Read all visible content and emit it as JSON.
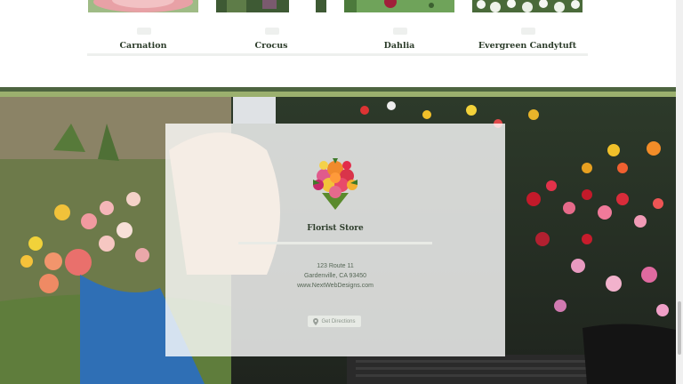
{
  "products": [
    {
      "name": "Carnation",
      "swatch": "#e8a1a6"
    },
    {
      "name": "Crocus",
      "swatch": "#7a5a6e"
    },
    {
      "name": "Dahlia",
      "swatch": "#6fa35a"
    },
    {
      "name": "Evergreen Candytuft",
      "swatch": "#dfe7d8"
    }
  ],
  "store": {
    "title": "Florist Store",
    "address_line1": "123 Route 11",
    "address_line2": "Gardenville, CA 93450",
    "website": "www.NextWebDesigns.com",
    "directions_label": "Get Directions",
    "directions_icon": "map-pin-icon"
  },
  "colors": {
    "band_dark": "#4d6440",
    "band_light": "#9bb06e",
    "accent_text": "#2e3e2c"
  }
}
